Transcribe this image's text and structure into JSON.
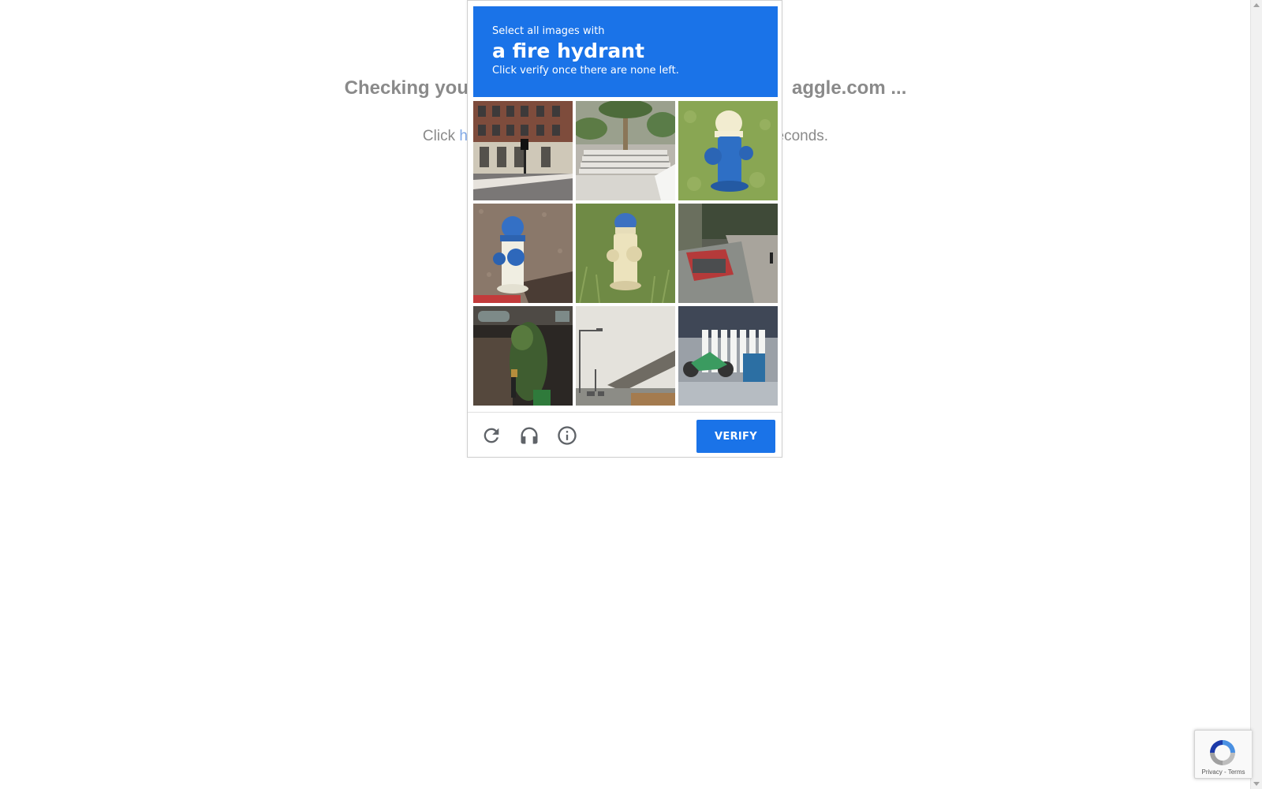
{
  "background": {
    "title": "Checking you                                        aggle.com ...",
    "title_left": "Checking you",
    "title_right": "aggle.com ...",
    "sub_left": "Click ",
    "sub_link": "he",
    "sub_right": "econds."
  },
  "captcha": {
    "instruction_line1": "Select all images with",
    "target": "a fire hydrant",
    "instruction_line3": "Click verify once there are none left.",
    "header_color": "#1a73e8",
    "tiles": [
      "building-street-corner",
      "stairs-palm-trees",
      "blue-white-hydrant-grass",
      "blue-white-hydrant-gravel",
      "white-hydrant-blue-cap-grass",
      "car-street-sidewalk",
      "storefront-with-plants",
      "street-lamps-overpass",
      "motorcycle-fence"
    ],
    "verify_label": "VERIFY",
    "icons": [
      "reload-icon",
      "headphones-icon",
      "info-icon"
    ]
  },
  "badge": {
    "links": "Privacy - Terms"
  }
}
